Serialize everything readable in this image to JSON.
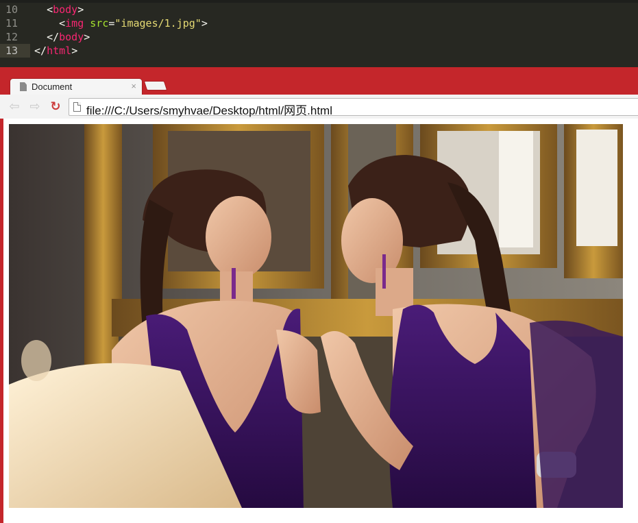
{
  "editor": {
    "lines": [
      {
        "number": "10",
        "indent": "  ",
        "parts": [
          [
            "p",
            "<"
          ],
          [
            "tag",
            "body"
          ],
          [
            "p",
            ">"
          ]
        ]
      },
      {
        "number": "11",
        "indent": "    ",
        "parts": [
          [
            "p",
            "<"
          ],
          [
            "tag",
            "img"
          ],
          [
            "p",
            " "
          ],
          [
            "attr",
            "src"
          ],
          [
            "p",
            "="
          ],
          [
            "str",
            "\"images/1.jpg\""
          ],
          [
            "p",
            ">"
          ]
        ]
      },
      {
        "number": "12",
        "indent": "  ",
        "parts": [
          [
            "p",
            "</"
          ],
          [
            "tag",
            "body"
          ],
          [
            "p",
            ">"
          ]
        ]
      },
      {
        "number": "13",
        "indent": "",
        "parts": [
          [
            "p",
            "</"
          ],
          [
            "tag",
            "html"
          ],
          [
            "p",
            ">"
          ]
        ]
      }
    ],
    "current_line": "13"
  },
  "browser": {
    "tab": {
      "title": "Document",
      "close": "×"
    },
    "nav": {
      "back": "back-arrow-icon",
      "forward": "forward-arrow-icon",
      "reload": "reload-icon"
    },
    "address": "file:///C:/Users/smyhvae/Desktop/html/网页.html"
  },
  "content": {
    "image": {
      "subject": "two-women-facing-mirror-photo"
    }
  },
  "colors": {
    "browser_frame": "#c4262b",
    "editor_bg": "#272822",
    "tag": "#f92672",
    "attr": "#a6e22e",
    "string": "#e6db74"
  }
}
